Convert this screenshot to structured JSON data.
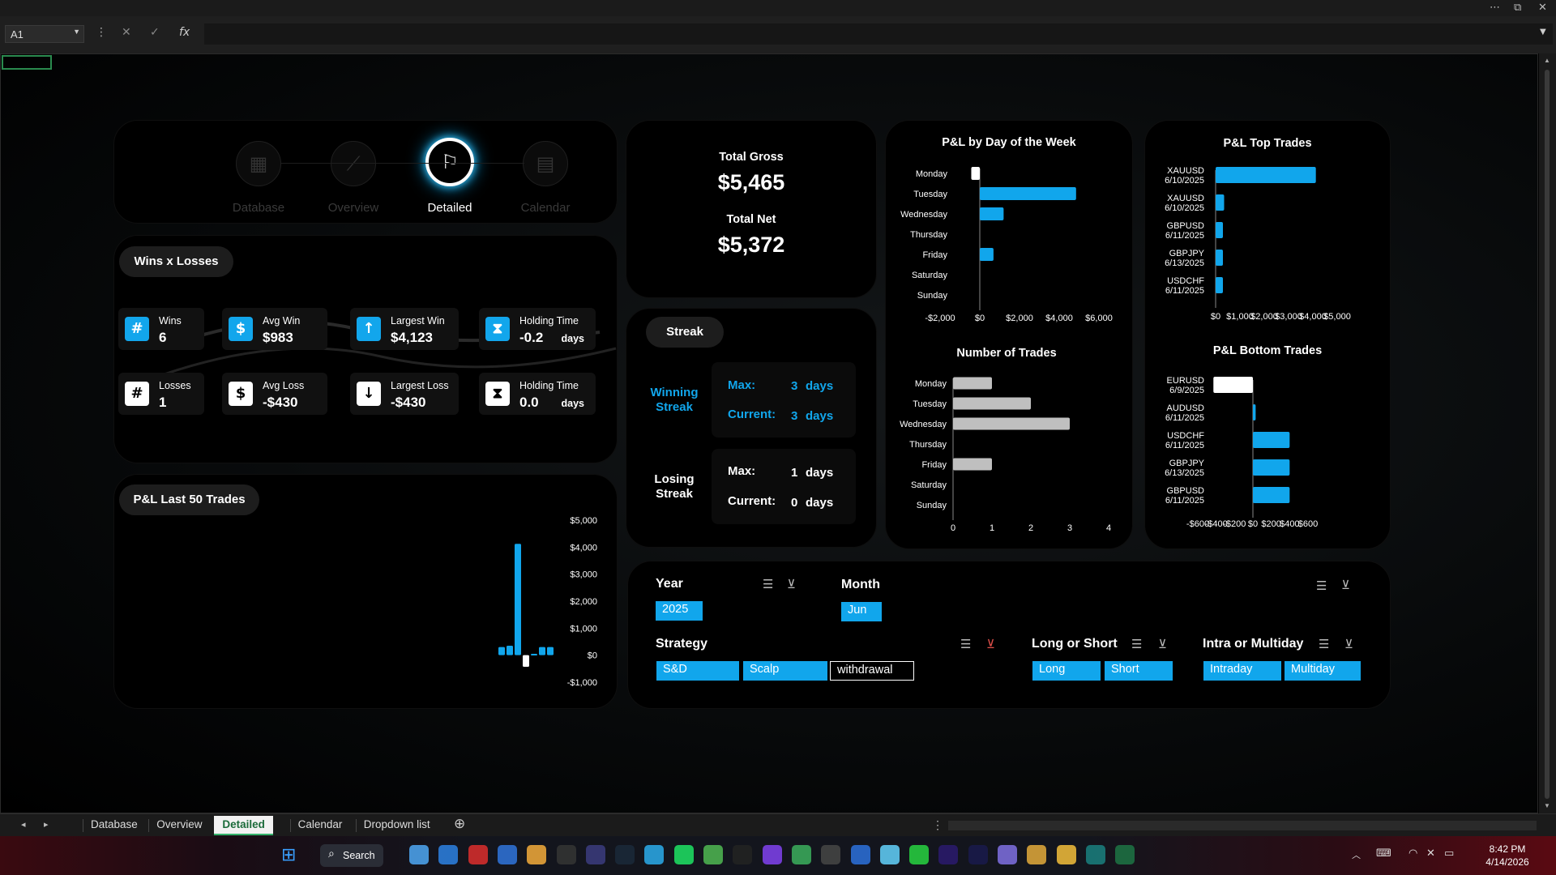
{
  "window": {
    "more": "⋯",
    "restore": "⧉",
    "close": "✕"
  },
  "formula_bar": {
    "name_box": "A1",
    "cancel": "✕",
    "enter": "✓",
    "fx": "fx",
    "formula": ""
  },
  "nav": [
    {
      "label": "Database",
      "icon": "database-grid-icon",
      "glyph": "▦"
    },
    {
      "label": "Overview",
      "icon": "overview-chart-icon",
      "glyph": "⟋"
    },
    {
      "label": "Detailed",
      "icon": "detailed-analytics-icon",
      "glyph": "⚐"
    },
    {
      "label": "Calendar",
      "icon": "calendar-icon",
      "glyph": "▤"
    }
  ],
  "totals": {
    "gross_label": "Total Gross",
    "gross_value": "$5,465",
    "net_label": "Total Net",
    "net_value": "$5,372"
  },
  "wins_losses": {
    "title": "Wins x Losses",
    "stats": [
      {
        "label": "Wins",
        "value": "6",
        "icon": "#",
        "style": "blue",
        "unit": ""
      },
      {
        "label": "Avg Win",
        "value": "$983",
        "icon": "$",
        "style": "blue",
        "unit": ""
      },
      {
        "label": "Largest Win",
        "value": "$4,123",
        "icon": "↑",
        "style": "blue",
        "unit": ""
      },
      {
        "label": "Holding Time",
        "value": "-0.2",
        "icon": "⧗",
        "style": "blue",
        "unit": "days"
      },
      {
        "label": "Losses",
        "value": "1",
        "icon": "#",
        "style": "white",
        "unit": ""
      },
      {
        "label": "Avg Loss",
        "value": "-$430",
        "icon": "$",
        "style": "white",
        "unit": ""
      },
      {
        "label": "Largest Loss",
        "value": "-$430",
        "icon": "↓",
        "style": "white",
        "unit": ""
      },
      {
        "label": "Holding Time",
        "value": "0.0",
        "icon": "⧗",
        "style": "white",
        "unit": "days"
      }
    ]
  },
  "streak": {
    "title": "Streak",
    "winning_label_1": "Winning",
    "winning_label_2": "Streak",
    "losing_label_1": "Losing",
    "losing_label_2": "Streak",
    "max_label": "Max:",
    "current_label": "Current:",
    "win_max": "3",
    "win_current": "3",
    "lose_max": "1",
    "lose_current": "0",
    "unit": "days"
  },
  "slicers": {
    "year": {
      "title": "Year",
      "options": [
        "2025"
      ]
    },
    "month": {
      "title": "Month",
      "options": [
        "Jun"
      ]
    },
    "strategy": {
      "title": "Strategy",
      "options": [
        "S&D",
        "Scalp",
        "withdrawal"
      ]
    },
    "long_short": {
      "title": "Long or Short",
      "options": [
        "Long",
        "Short"
      ]
    },
    "intra_multi": {
      "title": "Intra or Multiday",
      "options": [
        "Intraday",
        "Multiday"
      ]
    }
  },
  "sheet_tabs": [
    "Database",
    "Overview",
    "Detailed",
    "Calendar",
    "Dropdown list"
  ],
  "active_tab": "Detailed",
  "taskbar": {
    "search_label": "Search",
    "time": "8:42 PM",
    "date": "4/14/2026"
  },
  "colors": {
    "accent": "#11a6ec",
    "neg_bar": "#ffffff",
    "count_bar": "#bfbfbf"
  },
  "chart_data": [
    {
      "type": "bar",
      "orientation": "horizontal",
      "title": "P&L by Day of the Week",
      "categories": [
        "Monday",
        "Tuesday",
        "Wednesday",
        "Thursday",
        "Friday",
        "Saturday",
        "Sunday"
      ],
      "values": [
        -430,
        4850,
        1200,
        0,
        690,
        0,
        0
      ],
      "xlim": [
        -2000,
        6000
      ],
      "ticks": [
        "-$2,000",
        "$0",
        "$2,000",
        "$4,000",
        "$6,000"
      ]
    },
    {
      "type": "bar",
      "orientation": "horizontal",
      "title": "Number of Trades",
      "categories": [
        "Monday",
        "Tuesday",
        "Wednesday",
        "Thursday",
        "Friday",
        "Saturday",
        "Sunday"
      ],
      "values": [
        1,
        2,
        3,
        0,
        1,
        0,
        0
      ],
      "xlim": [
        0,
        4
      ],
      "ticks": [
        "0",
        "1",
        "2",
        "3",
        "4"
      ]
    },
    {
      "type": "bar",
      "orientation": "horizontal",
      "title": "P&L Top Trades",
      "categories": [
        [
          "XAUUSD",
          "6/10/2025"
        ],
        [
          "XAUUSD",
          "6/10/2025"
        ],
        [
          "GBPUSD",
          "6/11/2025"
        ],
        [
          "GBPJPY",
          "6/13/2025"
        ],
        [
          "USDCHF",
          "6/11/2025"
        ]
      ],
      "values": [
        4123,
        350,
        300,
        300,
        300
      ],
      "xlim": [
        0,
        5000
      ],
      "ticks": [
        "$0",
        "$1,000",
        "$2,000",
        "$3,000",
        "$4,000",
        "$5,000"
      ]
    },
    {
      "type": "bar",
      "orientation": "horizontal",
      "title": "P&L Bottom Trades",
      "categories": [
        [
          "EURUSD",
          "6/9/2025"
        ],
        [
          "AUDUSD",
          "6/11/2025"
        ],
        [
          "USDCHF",
          "6/11/2025"
        ],
        [
          "GBPJPY",
          "6/13/2025"
        ],
        [
          "GBPUSD",
          "6/11/2025"
        ]
      ],
      "values": [
        -430,
        30,
        400,
        400,
        400
      ],
      "xlim": [
        -600,
        600
      ],
      "ticks": [
        "-$600",
        "-$400",
        "-$200",
        "$0",
        "$200",
        "$400",
        "$600"
      ]
    },
    {
      "type": "bar",
      "title": "P&L Last 50 Trades",
      "values": [
        300,
        350,
        4123,
        -430,
        50,
        300,
        300
      ],
      "ylim": [
        -1000,
        5000
      ],
      "ticks": [
        "$5,000",
        "$4,000",
        "$3,000",
        "$2,000",
        "$1,000",
        "$0",
        "-$1,000"
      ]
    }
  ]
}
